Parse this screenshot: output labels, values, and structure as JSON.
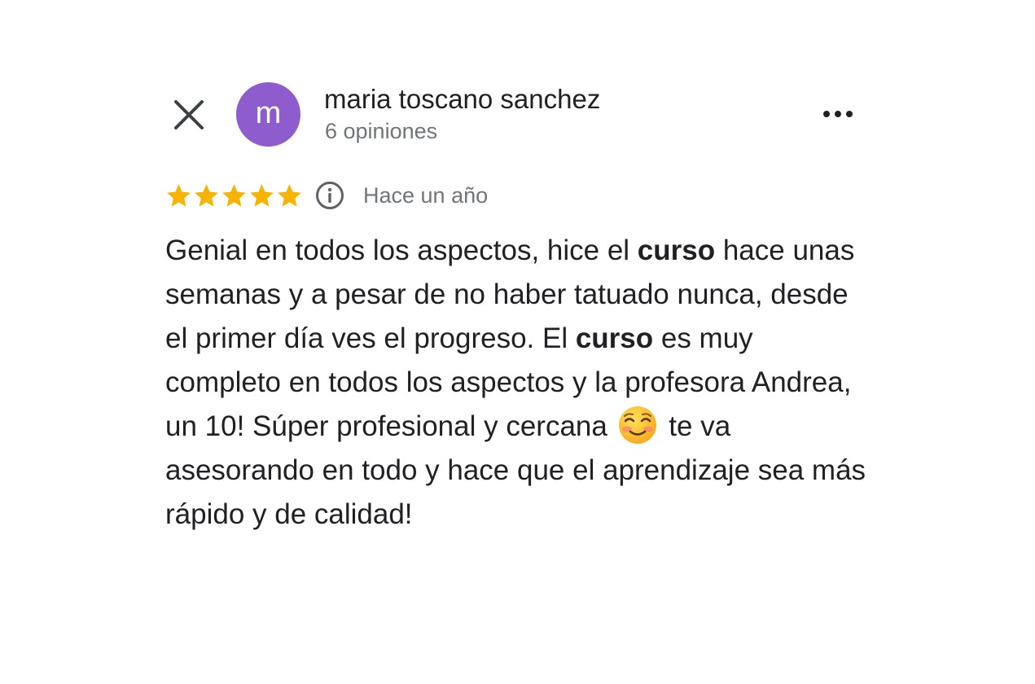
{
  "header": {
    "author_name": "maria toscano sanchez",
    "review_count": "6 opiniones",
    "avatar_letter": "m",
    "avatar_color": "#8e5ccc",
    "close_icon": "close-icon",
    "more_icon": "more-horizontal-icon"
  },
  "review": {
    "rating": 5,
    "rating_max": 5,
    "star_color": "#f6b400",
    "date": "Hace un año",
    "info_icon": "info-icon",
    "text_segments": [
      {
        "text": "Genial en todos los aspectos, hice el ",
        "bold": false
      },
      {
        "text": "curso",
        "bold": true
      },
      {
        "text": " hace unas semanas y a pesar de no haber tatuado nunca, desde el primer día ves el progreso. El ",
        "bold": false
      },
      {
        "text": "curso",
        "bold": true
      },
      {
        "text": " es muy completo en todos los aspectos y la profesora Andrea, un 10! Súper profesional y cercana ",
        "bold": false
      },
      {
        "emoji": "smiling-face-emoji"
      },
      {
        "text": " te va asesorando en todo y hace que el aprendizaje sea más rápido y de calidad!",
        "bold": false
      }
    ]
  }
}
